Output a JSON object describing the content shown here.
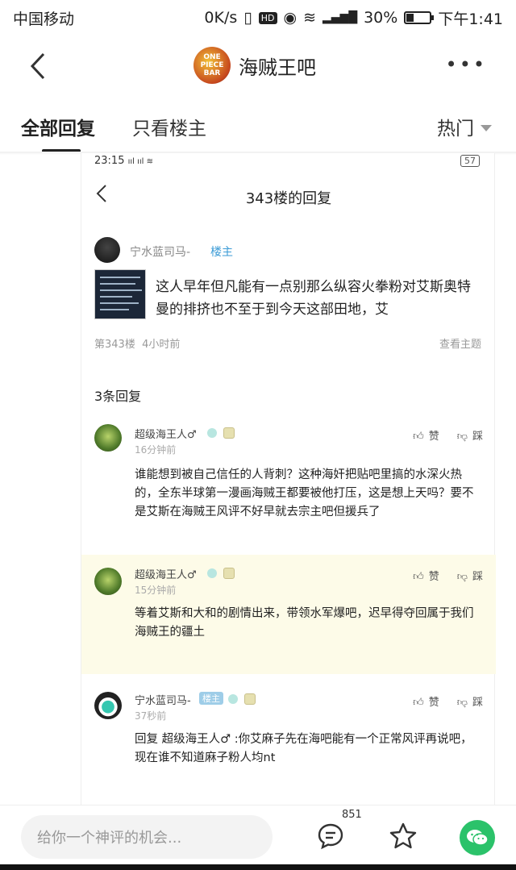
{
  "status_bar": {
    "carrier": "中国移动",
    "speed": "0K/s",
    "battery": "30%",
    "time": "下午1:41"
  },
  "header": {
    "back_icon": "chevron-left-icon",
    "logo_text": "ONE PIECE BAR",
    "title": "海贼王吧",
    "more_icon": "more-dots-icon"
  },
  "tabs": {
    "all": "全部回复",
    "op_only": "只看楼主",
    "sort": "热门"
  },
  "inner": {
    "status_time": "23:15",
    "status_battery": "57",
    "title": "343楼的回复",
    "op": {
      "name": "宁水蓝司马-",
      "tag": "楼主",
      "content": "这人早年但凡能有一点别那么纵容火拳粉对艾斯奥特曼的排挤也不至于到今天这部田地，艾",
      "floor": "第343楼",
      "time": "4小时前",
      "view": "查看主题"
    },
    "reply_count": "3条回复",
    "replies": [
      {
        "name": "超级海王人♂",
        "time": "16分钟前",
        "text": "谁能想到被自己信任的人背刺？这种海奸把贴吧里搞的水深火热的，全东半球第一漫画海贼王都要被他打压，这是想上天吗？要不是艾斯在海贼王风评不好早就去宗主吧但援兵了",
        "like": "赞",
        "dislike": "踩"
      },
      {
        "name": "超级海王人♂",
        "time": "15分钟前",
        "text": "等着艾斯和大和的剧情出来，带领水军爆吧，迟早得夺回属于我们海贼王的疆土",
        "like": "赞",
        "dislike": "踩"
      },
      {
        "name": "宁水蓝司马-",
        "tag": "楼主",
        "time": "37秒前",
        "text": "回复 超级海王人♂ :你艾麻子先在海吧能有一个正常风评再说吧，现在谁不知道麻子粉人均nt",
        "like": "赞",
        "dislike": "踩"
      }
    ]
  },
  "bottom": {
    "placeholder": "给你一个神评的机会...",
    "comment_count": "851"
  }
}
